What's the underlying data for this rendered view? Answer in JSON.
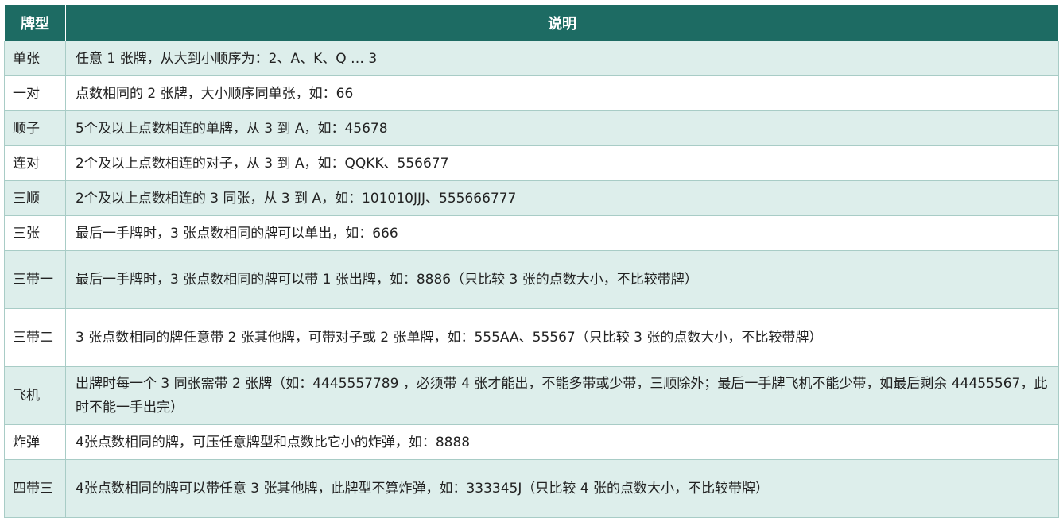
{
  "table": {
    "headers": [
      "牌型",
      "说明"
    ],
    "rows": [
      {
        "type": "单张",
        "desc": "任意 1 张牌，从大到小顺序为：2、A、K、Q … 3"
      },
      {
        "type": "一对",
        "desc": "点数相同的 2 张牌，大小顺序同单张，如：66"
      },
      {
        "type": "顺子",
        "desc": "5个及以上点数相连的单牌，从 3 到 A，如：45678"
      },
      {
        "type": "连对",
        "desc": "2个及以上点数相连的对子，从 3 到 A，如：QQKK、556677"
      },
      {
        "type": "三顺",
        "desc": "2个及以上点数相连的 3 同张，从 3 到 A，如：101010JJJ、555666777"
      },
      {
        "type": "三张",
        "desc": "最后一手牌时，3 张点数相同的牌可以单出，如：666"
      },
      {
        "type": "三带一",
        "desc": "最后一手牌时，3 张点数相同的牌可以带 1 张出牌，如：8886（只比较 3 张的点数大小，不比较带牌）"
      },
      {
        "type": "三带二",
        "desc": "3 张点数相同的牌任意带 2 张其他牌，可带对子或 2 张单牌，如：555AA、55567（只比较 3 张的点数大小，不比较带牌）"
      },
      {
        "type": "飞机",
        "desc": "出牌时每一个 3 同张需带 2 张牌（如：4445557789 ，必须带 4 张才能出，不能多带或少带，三顺除外；最后一手牌飞机不能少带，如最后剩余 44455567，此时不能一手出完）"
      },
      {
        "type": "炸弹",
        "desc": "4张点数相同的牌，可压任意牌型和点数比它小的炸弹，如：8888"
      },
      {
        "type": "四带三",
        "desc": "4张点数相同的牌可以带任意 3 张其他牌，此牌型不算炸弹，如：333345J（只比较 4 张的点数大小，不比较带牌）"
      }
    ]
  }
}
